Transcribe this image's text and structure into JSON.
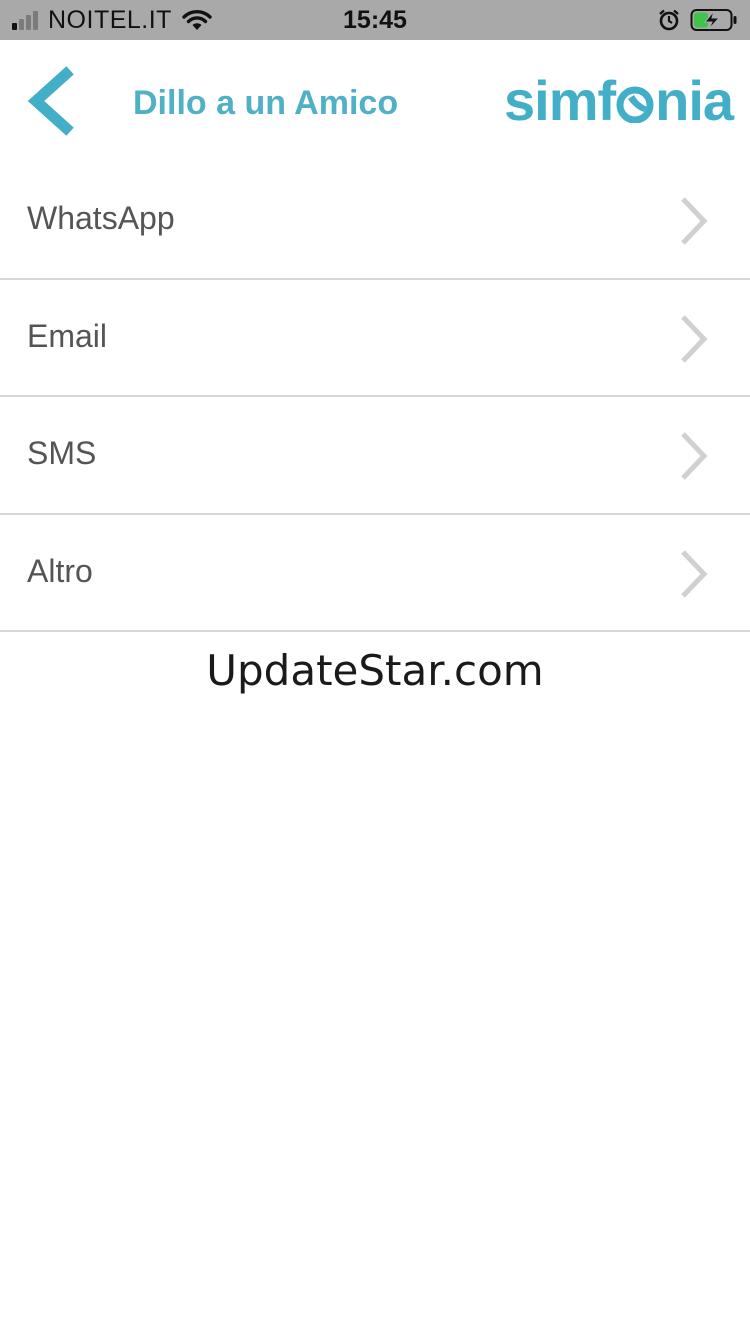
{
  "status_bar": {
    "carrier": "NOITEL.IT",
    "time": "15:45",
    "signal_bars_active": 1,
    "signal_bars_total": 4,
    "battery_level": 0.4,
    "battery_charging": true,
    "icons": [
      "signal-icon",
      "wifi-icon",
      "alarm-icon",
      "battery-icon"
    ]
  },
  "nav": {
    "back_icon": "chevron-left-icon",
    "title": "Dillo a un Amico",
    "logo_text_left": "simf",
    "logo_text_right": "nia"
  },
  "colors": {
    "accent": "#43aec7",
    "title": "#4fb0c6",
    "status_bar_bg": "#a9a9a9",
    "divider": "#d6d6d6",
    "label": "#555555",
    "chevron": "#d0d0d0"
  },
  "share_options": [
    {
      "label": "WhatsApp",
      "icon": "chevron-right-icon"
    },
    {
      "label": "Email",
      "icon": "chevron-right-icon"
    },
    {
      "label": "SMS",
      "icon": "chevron-right-icon"
    },
    {
      "label": "Altro",
      "icon": "chevron-right-icon"
    }
  ],
  "watermark": "UpdateStar.com"
}
